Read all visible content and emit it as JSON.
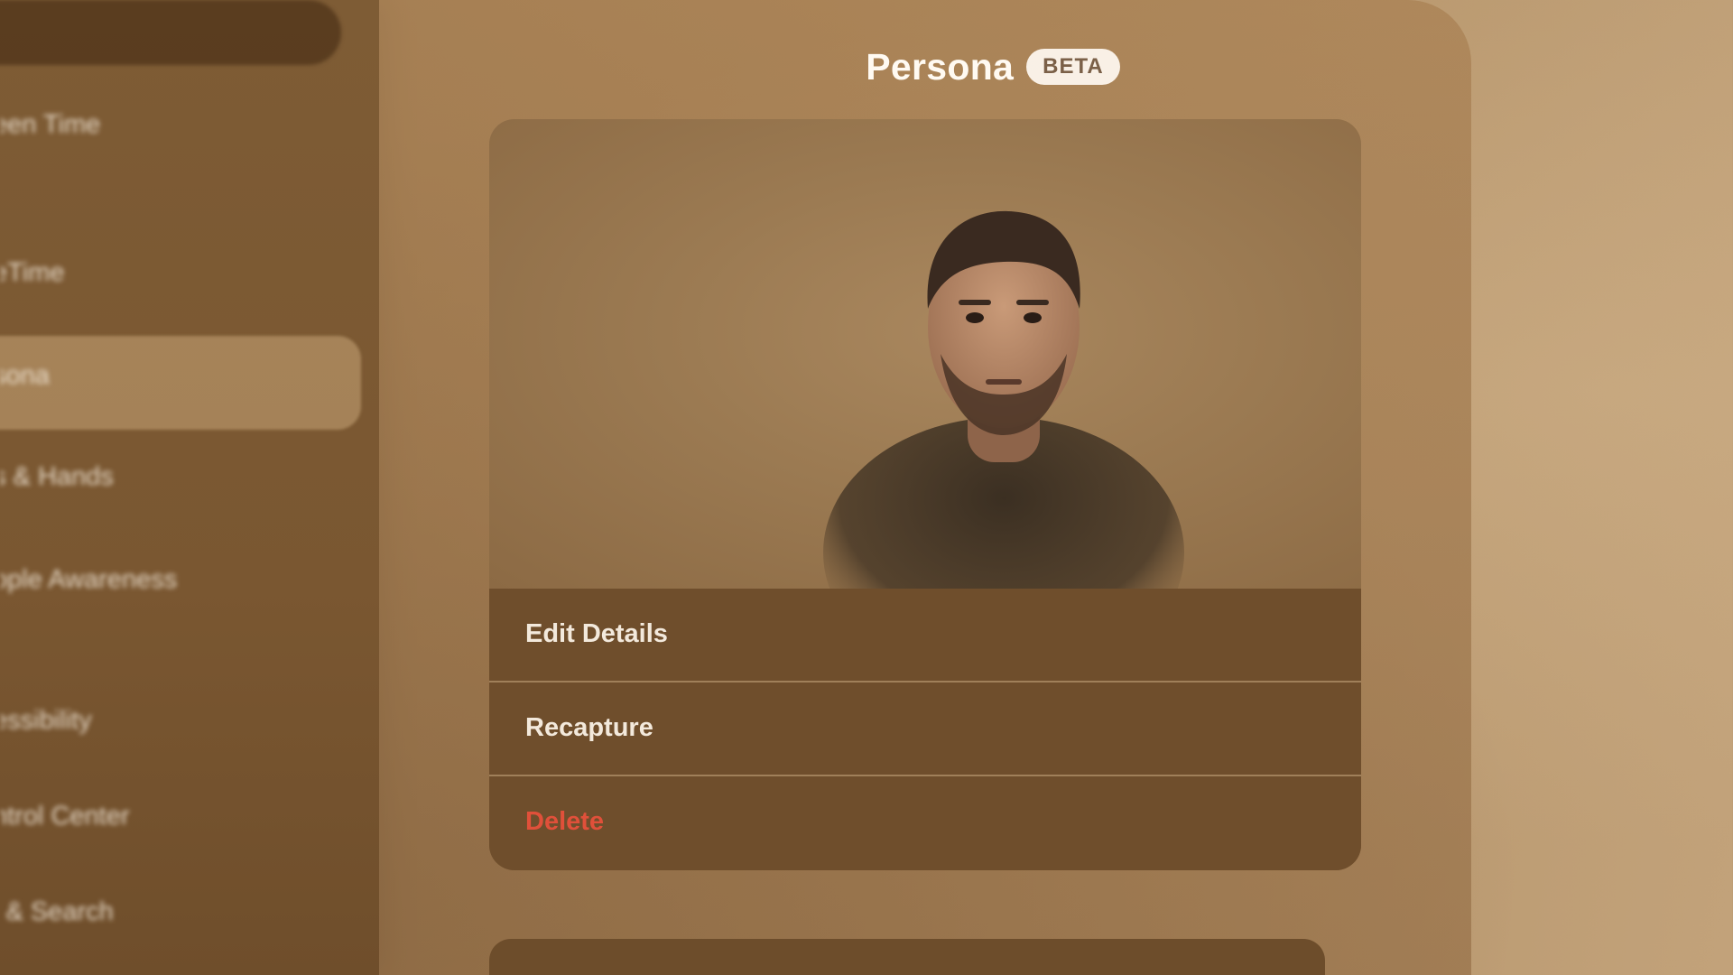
{
  "sidebar": {
    "items": [
      {
        "label": "een Time"
      },
      {
        "label": "eTime"
      },
      {
        "label": "sona",
        "selected": true
      },
      {
        "label": "s & Hands"
      },
      {
        "label": "ople Awareness"
      },
      {
        "label": "essibility"
      },
      {
        "label": "ntrol Center"
      },
      {
        "label": "i & Search"
      }
    ]
  },
  "header": {
    "title": "Persona",
    "badge": "BETA"
  },
  "persona": {
    "actions": [
      {
        "label": "Edit Details"
      },
      {
        "label": "Recapture"
      },
      {
        "label": "Delete"
      }
    ]
  },
  "bottom_card": {
    "label": "..."
  },
  "colors": {
    "accent": "#5aa0e8",
    "destructive": "#e0503a",
    "panel": "#a07a50"
  },
  "icons": [
    "avatar-icon"
  ]
}
